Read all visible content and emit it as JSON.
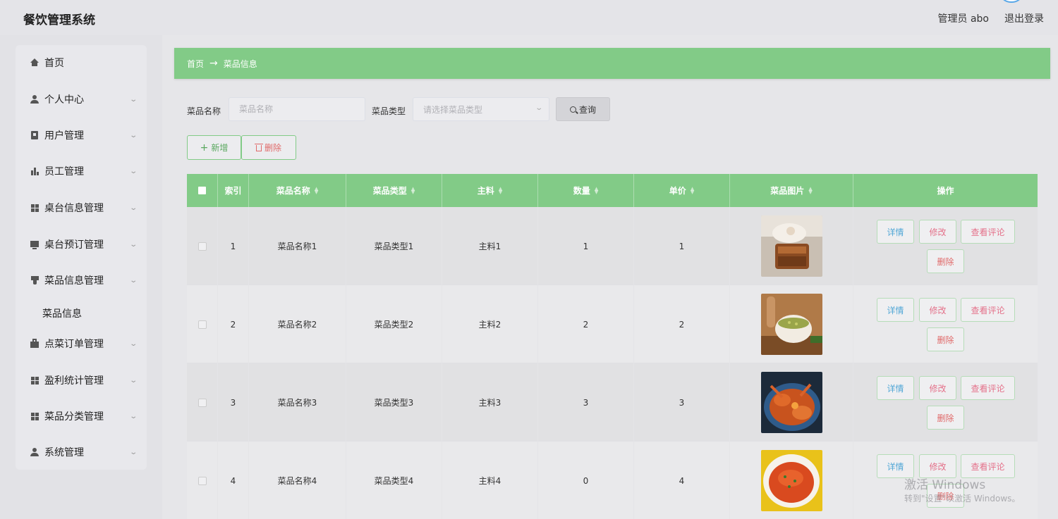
{
  "app": {
    "title": "餐饮管理系统",
    "user_label": "管理员 abo",
    "logout_label": "退出登录"
  },
  "sidebar": {
    "items": [
      {
        "label": "首页",
        "icon": "home-icon"
      },
      {
        "label": "个人中心",
        "icon": "user-icon"
      },
      {
        "label": "用户管理",
        "icon": "clipboard-icon"
      },
      {
        "label": "员工管理",
        "icon": "bar-chart-icon"
      },
      {
        "label": "桌台信息管理",
        "icon": "grid-icon"
      },
      {
        "label": "桌台预订管理",
        "icon": "monitor-icon"
      },
      {
        "label": "菜品信息管理",
        "icon": "cup-icon"
      },
      {
        "label": "点菜订单管理",
        "icon": "bag-icon"
      },
      {
        "label": "盈利统计管理",
        "icon": "grid-icon"
      },
      {
        "label": "菜品分类管理",
        "icon": "grid-icon"
      },
      {
        "label": "系统管理",
        "icon": "user-icon"
      }
    ],
    "submenu": {
      "label": "菜品信息"
    }
  },
  "breadcrumb": {
    "home": "首页",
    "arrow": "→",
    "current": "菜品信息"
  },
  "search": {
    "name_label": "菜品名称",
    "name_placeholder": "菜品名称",
    "type_label": "菜品类型",
    "type_placeholder": "请选择菜品类型",
    "query_label": "查询"
  },
  "actions": {
    "add_label": "新增",
    "delete_label": "删除"
  },
  "table": {
    "headers": [
      "索引",
      "菜品名称",
      "菜品类型",
      "主料",
      "数量",
      "单价",
      "菜品图片",
      "操作"
    ],
    "rows": [
      {
        "index": "1",
        "name": "菜品名称1",
        "type": "菜品类型1",
        "ingredient": "主料1",
        "qty": "1",
        "price": "1",
        "image": "dessert-image"
      },
      {
        "index": "2",
        "name": "菜品名称2",
        "type": "菜品类型2",
        "ingredient": "主料2",
        "qty": "2",
        "price": "2",
        "image": "soup-image"
      },
      {
        "index": "3",
        "name": "菜品名称3",
        "type": "菜品类型3",
        "ingredient": "主料3",
        "qty": "3",
        "price": "3",
        "image": "crab-image"
      },
      {
        "index": "4",
        "name": "菜品名称4",
        "type": "菜品类型4",
        "ingredient": "主料4",
        "qty": "0",
        "price": "4",
        "image": "fish-head-image"
      }
    ],
    "row_actions": {
      "detail": "详情",
      "edit": "修改",
      "review": "查看评论",
      "delete": "删除"
    }
  },
  "watermark": {
    "line1": "激活 Windows",
    "line2": "转到\"设置\"以激活 Windows。"
  },
  "colors": {
    "accent_green": "#82cb87",
    "detail_blue": "#52a7d6",
    "danger_red": "#e06a6a"
  }
}
